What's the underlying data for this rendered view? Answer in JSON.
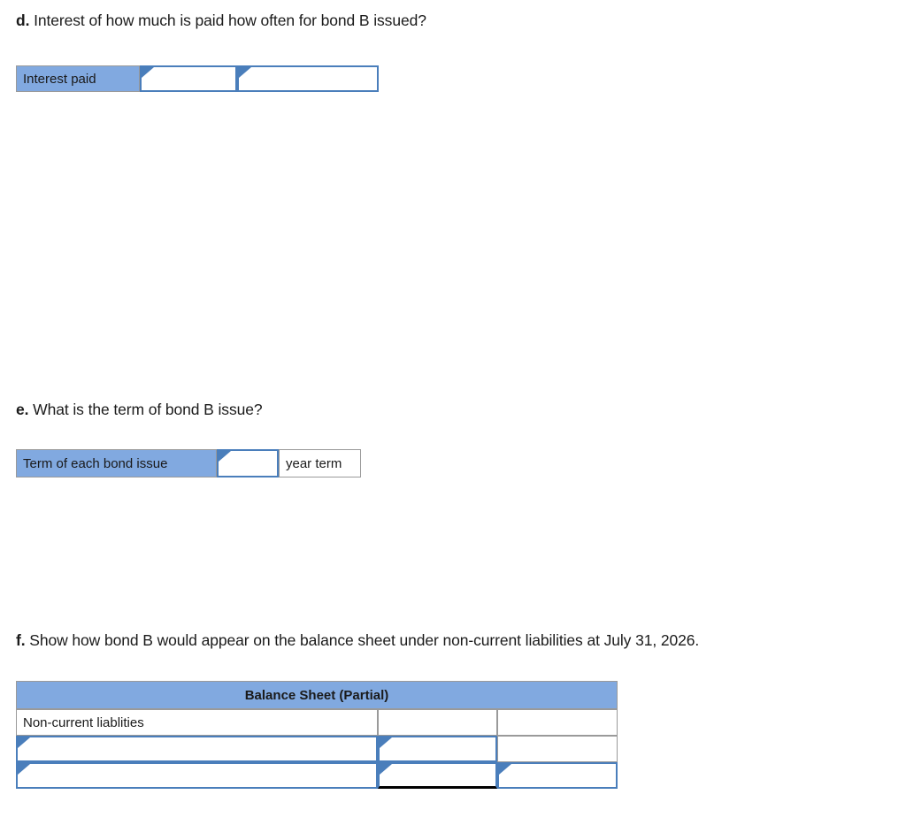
{
  "sections": [
    {
      "id": "d",
      "label": "d.",
      "question": " Interest of how much is paid how often for bond B issued?",
      "table": {
        "name": "interest-paid",
        "row_label": "Interest paid",
        "input_1": "",
        "input_2": ""
      }
    },
    {
      "id": "e",
      "label": "e.",
      "question": " What is the term of bond B issue?",
      "table": {
        "name": "bond-term",
        "row_label": "Term of each bond issue",
        "input_1": "",
        "suffix": "year term"
      }
    },
    {
      "id": "f",
      "label": "f.",
      "question": " Show how bond B would appear on the balance sheet under non-current liabilities at July 31, 2026.",
      "table": {
        "name": "balance-sheet",
        "header": "Balance Sheet (Partial)",
        "rows": [
          {
            "label": "Non-current liablities",
            "amount_1": "",
            "amount_2": ""
          },
          {
            "label": "",
            "amount_1": "",
            "amount_2": ""
          },
          {
            "label": "",
            "amount_1": "",
            "amount_2": ""
          }
        ]
      }
    }
  ],
  "colors": {
    "label_blue": "#81a9e0",
    "input_border_blue": "#4a7ebb",
    "grid_grey": "#9a9a9a",
    "total_rule": "#000000"
  }
}
